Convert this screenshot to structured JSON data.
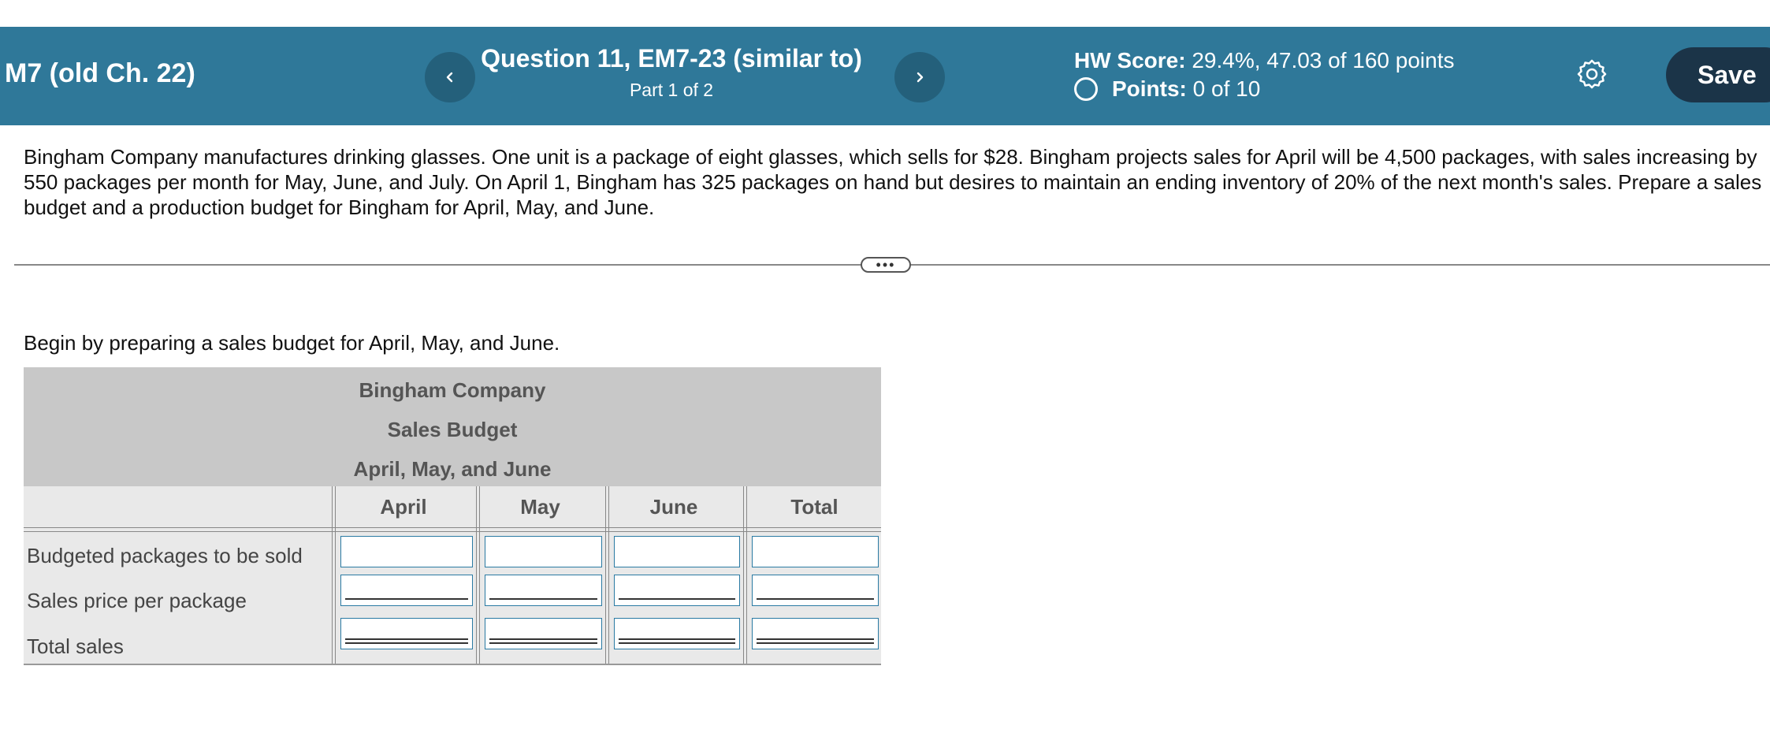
{
  "header": {
    "assignment_title": "M7 (old Ch. 22)",
    "question_title": "Question 11, EM7-23 (similar to)",
    "question_part": "Part 1 of 2",
    "hw_score_label": "HW Score:",
    "hw_score_value": "29.4%, 47.03 of 160 points",
    "points_label": "Points:",
    "points_value": "0 of 10",
    "save_label": "Save",
    "prev_icon": "chevron-left-icon",
    "next_icon": "chevron-right-icon",
    "settings_icon": "gear-icon",
    "status_icon": "empty-circle-icon",
    "colors": {
      "header_bg": "#2f7899",
      "save_bg": "#1b3448"
    }
  },
  "question": {
    "text": "Bingham Company manufactures drinking glasses. One unit is a package of eight glasses, which sells for $28. Bingham projects sales for April will be 4,500 packages, with sales increasing by 550 packages per month for May, June, and July. On April 1, Bingham has 325 packages on hand but desires to maintain an ending inventory of 20% of the next month's sales. Prepare a sales budget and a production budget for Bingham for April, May, and June.",
    "instruction": "Begin by preparing a sales budget for April, May, and June."
  },
  "budget_table": {
    "company": "Bingham Company",
    "title": "Sales Budget",
    "period": "April, May, and June",
    "columns": [
      "April",
      "May",
      "June",
      "Total"
    ],
    "rows": [
      {
        "label": "Budgeted packages to be sold",
        "values": [
          "",
          "",
          "",
          ""
        ]
      },
      {
        "label": "Sales price per package",
        "values": [
          "",
          "",
          "",
          ""
        ]
      },
      {
        "label": "Total sales",
        "values": [
          "",
          "",
          "",
          ""
        ]
      }
    ]
  }
}
